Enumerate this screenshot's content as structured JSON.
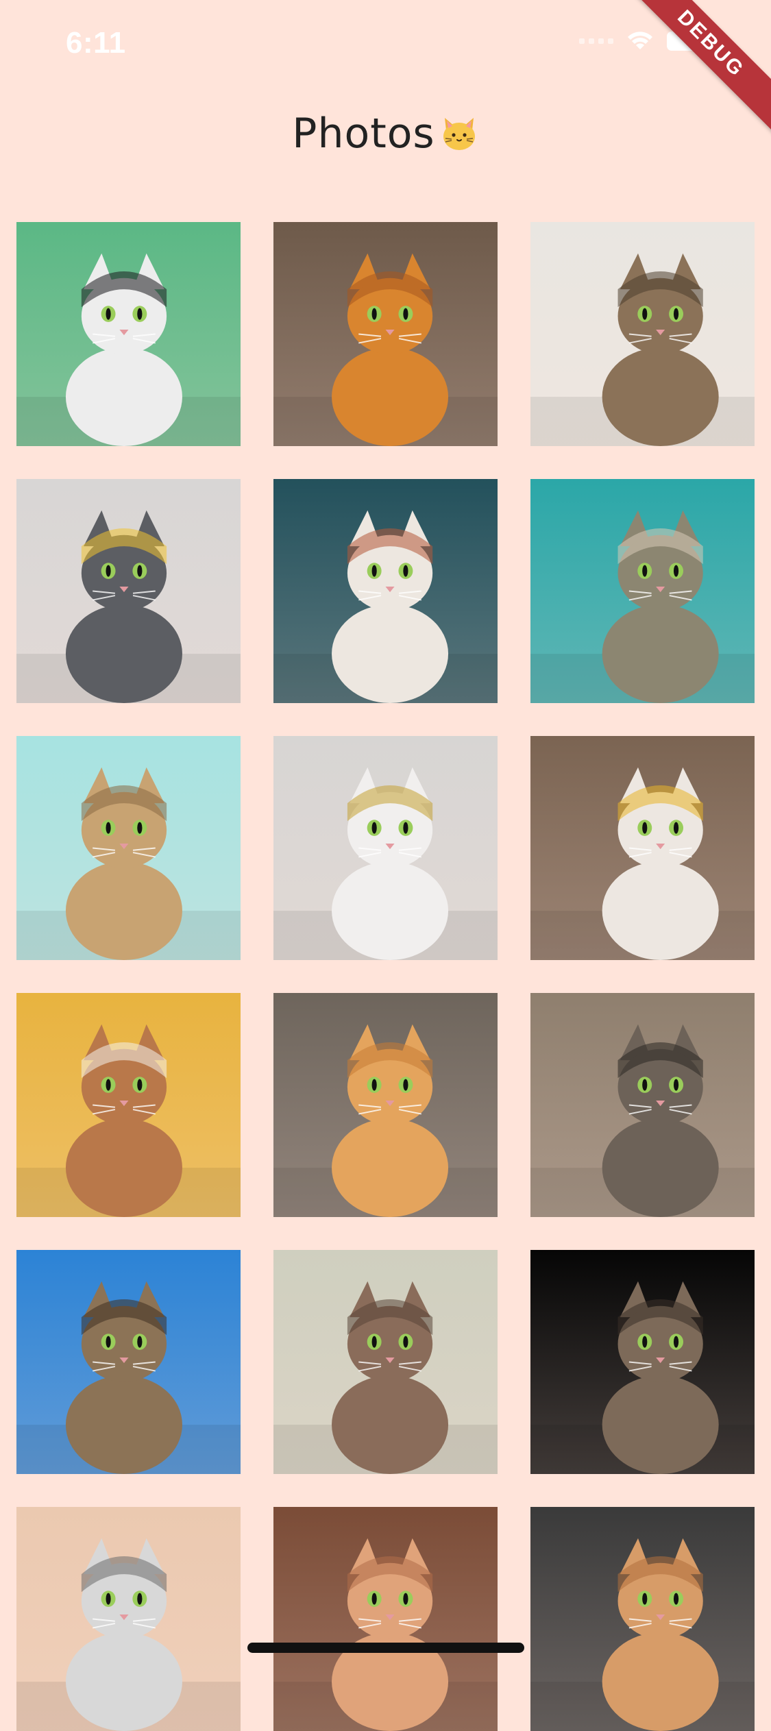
{
  "status_bar": {
    "time": "6:11",
    "icons": [
      "cellular-signal-icon",
      "wifi-icon",
      "battery-icon"
    ]
  },
  "debug_banner": {
    "label": "DEBUG",
    "color": "#B7343A"
  },
  "header": {
    "title": "Photos",
    "emoji_icon": "cat-face-icon"
  },
  "theme": {
    "background": "#FFE4DA"
  },
  "photos": [
    {
      "icon": "cat-photo-icon",
      "bg": "#5BB885",
      "fur": "#EDEDED",
      "accent": "#1B1B1F"
    },
    {
      "icon": "cat-photo-icon",
      "bg": "#6E5A4A",
      "fur": "#D9852F",
      "accent": "#A7581F"
    },
    {
      "icon": "cat-photo-icon",
      "bg": "#E9E6E1",
      "fur": "#8B7258",
      "accent": "#4E3F30"
    },
    {
      "icon": "cat-photo-icon",
      "bg": "#D8D6D5",
      "fur": "#5C5E63",
      "accent": "#F1C232"
    },
    {
      "icon": "cat-photo-icon",
      "bg": "#23515C",
      "fur": "#EDE7E0",
      "accent": "#B55A3A"
    },
    {
      "icon": "cat-photo-icon",
      "bg": "#2BA7A8",
      "fur": "#8C8671",
      "accent": "#D7CBB6"
    },
    {
      "icon": "cat-photo-icon",
      "bg": "#A7E3E1",
      "fur": "#C8A372",
      "accent": "#8A6B45"
    },
    {
      "icon": "cat-photo-icon",
      "bg": "#D7D5D3",
      "fur": "#F1EFEE",
      "accent": "#C4A234"
    },
    {
      "icon": "cat-photo-icon",
      "bg": "#7B6452",
      "fur": "#EDE7E1",
      "accent": "#E8B52A"
    },
    {
      "icon": "cat-photo-icon",
      "bg": "#E8B33F",
      "fur": "#B9784A",
      "accent": "#F4F0EA"
    },
    {
      "icon": "cat-photo-icon",
      "bg": "#6E655C",
      "fur": "#E4A45D",
      "accent": "#C77C35"
    },
    {
      "icon": "cat-photo-icon",
      "bg": "#8F7F6E",
      "fur": "#6D6258",
      "accent": "#2C2824"
    },
    {
      "icon": "cat-photo-icon",
      "bg": "#2C83D6",
      "fur": "#8C7356",
      "accent": "#3F2F22"
    },
    {
      "icon": "cat-photo-icon",
      "bg": "#CFCFBF",
      "fur": "#8A6C5A",
      "accent": "#5A4638"
    },
    {
      "icon": "cat-photo-icon",
      "bg": "#060606",
      "fur": "#7D6A59",
      "accent": "#3A3028"
    },
    {
      "icon": "cat-photo-icon",
      "bg": "#EBC9B0",
      "fur": "#D8D8D8",
      "accent": "#6E6E6E"
    },
    {
      "icon": "cat-photo-icon",
      "bg": "#7B4C37",
      "fur": "#E0A37A",
      "accent": "#B16E48"
    },
    {
      "icon": "cat-photo-icon",
      "bg": "#3A3A3A",
      "fur": "#D79C68",
      "accent": "#B06F3C"
    }
  ]
}
